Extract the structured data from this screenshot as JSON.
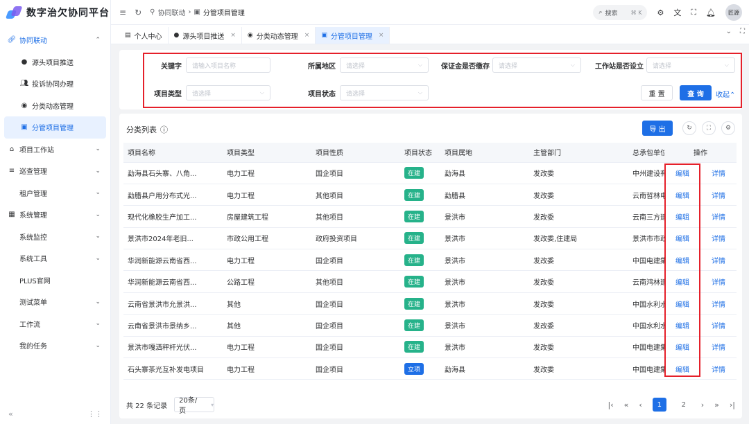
{
  "app": {
    "title": "数字治欠协同平台"
  },
  "colors": {
    "primary": "#1e6fe6",
    "tag_building": "#26b28a",
    "tag_project": "#1e6fe6",
    "highlight": "#e5202a"
  },
  "sidebar": {
    "items": [
      {
        "label": "协同联动",
        "icon": "link-icon",
        "level": "top",
        "expanded": true
      },
      {
        "label": "源头项目推送",
        "icon": "dot-icon",
        "level": "sub"
      },
      {
        "label": "投诉协同办理",
        "icon": "people-icon",
        "level": "sub"
      },
      {
        "label": "分类动态管理",
        "icon": "badge-icon",
        "level": "sub"
      },
      {
        "label": "分管项目管理",
        "icon": "board-icon",
        "level": "sub",
        "active": true
      },
      {
        "label": "项目工作站",
        "icon": "home-icon",
        "level": "top"
      },
      {
        "label": "巡查管理",
        "icon": "list-icon",
        "level": "top"
      },
      {
        "label": "租户管理",
        "level": "plain"
      },
      {
        "label": "系统管理",
        "icon": "grid-icon",
        "level": "top"
      },
      {
        "label": "系统监控",
        "level": "plain"
      },
      {
        "label": "系统工具",
        "level": "plain"
      },
      {
        "label": "PLUS官网",
        "level": "plain"
      },
      {
        "label": "测试菜单",
        "level": "plain"
      },
      {
        "label": "工作流",
        "level": "plain"
      },
      {
        "label": "我的任务",
        "level": "plain"
      }
    ]
  },
  "header": {
    "breadcrumb": [
      "协同联动",
      "分管项目管理"
    ],
    "search": {
      "label": "搜索",
      "shortcut": "⌘ K"
    },
    "avatar": "匠源"
  },
  "tabs": [
    {
      "label": "个人中心",
      "closable": false
    },
    {
      "label": "源头项目推送",
      "closable": true
    },
    {
      "label": "分类动态管理",
      "closable": true
    },
    {
      "label": "分管项目管理",
      "closable": true,
      "active": true
    }
  ],
  "filter": {
    "keyword_label": "关键字",
    "keyword_placeholder": "请输入项目名称",
    "region_label": "所属地区",
    "region_placeholder": "请选择",
    "deposit_label": "保证金是否缴存",
    "deposit_placeholder": "请选择",
    "station_label": "工作站是否设立",
    "station_placeholder": "请选择",
    "type_label": "项目类型",
    "type_placeholder": "请选择",
    "status_label": "项目状态",
    "status_placeholder": "请选择",
    "reset": "重 置",
    "query": "查 询",
    "collapse": "收起"
  },
  "list": {
    "title": "分类列表",
    "export": "导 出",
    "columns": [
      "项目名称",
      "项目类型",
      "项目性质",
      "项目状态",
      "项目属地",
      "主管部门",
      "总承包单位",
      "操作"
    ],
    "rows": [
      {
        "name": "勐海县石头寨、八角...",
        "type": "电力工程",
        "nature": "国企项目",
        "status": "在建",
        "area": "勐海县",
        "dept": "发改委",
        "contractor": "中州建设有限公司"
      },
      {
        "name": "勐腊县户用分布式光...",
        "type": "电力工程",
        "nature": "其他项目",
        "status": "在建",
        "area": "勐腊县",
        "dept": "发改委",
        "contractor": "云南哲林电力有限公司"
      },
      {
        "name": "现代化橡胶生产加工...",
        "type": "房屋建筑工程",
        "nature": "其他项目",
        "status": "在建",
        "area": "景洪市",
        "dept": "发改委",
        "contractor": "云南三方建设有限公司"
      },
      {
        "name": "景洪市2024年老旧...",
        "type": "市政公用工程",
        "nature": "政府投资项目",
        "status": "在建",
        "area": "景洪市",
        "dept": "发改委,住建局",
        "contractor": "景洪市市政工程有限公司"
      },
      {
        "name": "华润新能源云南省西...",
        "type": "电力工程",
        "nature": "国企项目",
        "status": "在建",
        "area": "景洪市",
        "dept": "发改委",
        "contractor": "中国电建集团有限公司"
      },
      {
        "name": "华润新能源云南省西...",
        "type": "公路工程",
        "nature": "其他项目",
        "status": "在建",
        "area": "景洪市",
        "dept": "发改委",
        "contractor": "云南鸿林建设有限公司"
      },
      {
        "name": "云南省景洪市允景洪...",
        "type": "其他",
        "nature": "国企项目",
        "status": "在建",
        "area": "景洪市",
        "dept": "发改委",
        "contractor": "中国水利水电有限公司"
      },
      {
        "name": "云南省景洪市景纳乡...",
        "type": "其他",
        "nature": "国企项目",
        "status": "在建",
        "area": "景洪市",
        "dept": "发改委",
        "contractor": "中国水利水电有限公司"
      },
      {
        "name": "景洪市嘎洒秤杆光伏...",
        "type": "电力工程",
        "nature": "国企项目",
        "status": "在建",
        "area": "景洪市",
        "dept": "发改委",
        "contractor": "中国电建集团有限公司"
      },
      {
        "name": "石头寨茶光互补发电项目",
        "type": "电力工程",
        "nature": "国企项目",
        "status": "立项",
        "area": "勐海县",
        "dept": "发改委",
        "contractor": "中国电建集团有限公司"
      }
    ],
    "edit": "编辑",
    "detail": "详情"
  },
  "pager": {
    "total": "共 22 条记录",
    "page_size": "20条/页",
    "pages": [
      "1",
      "2"
    ],
    "current": "1"
  }
}
